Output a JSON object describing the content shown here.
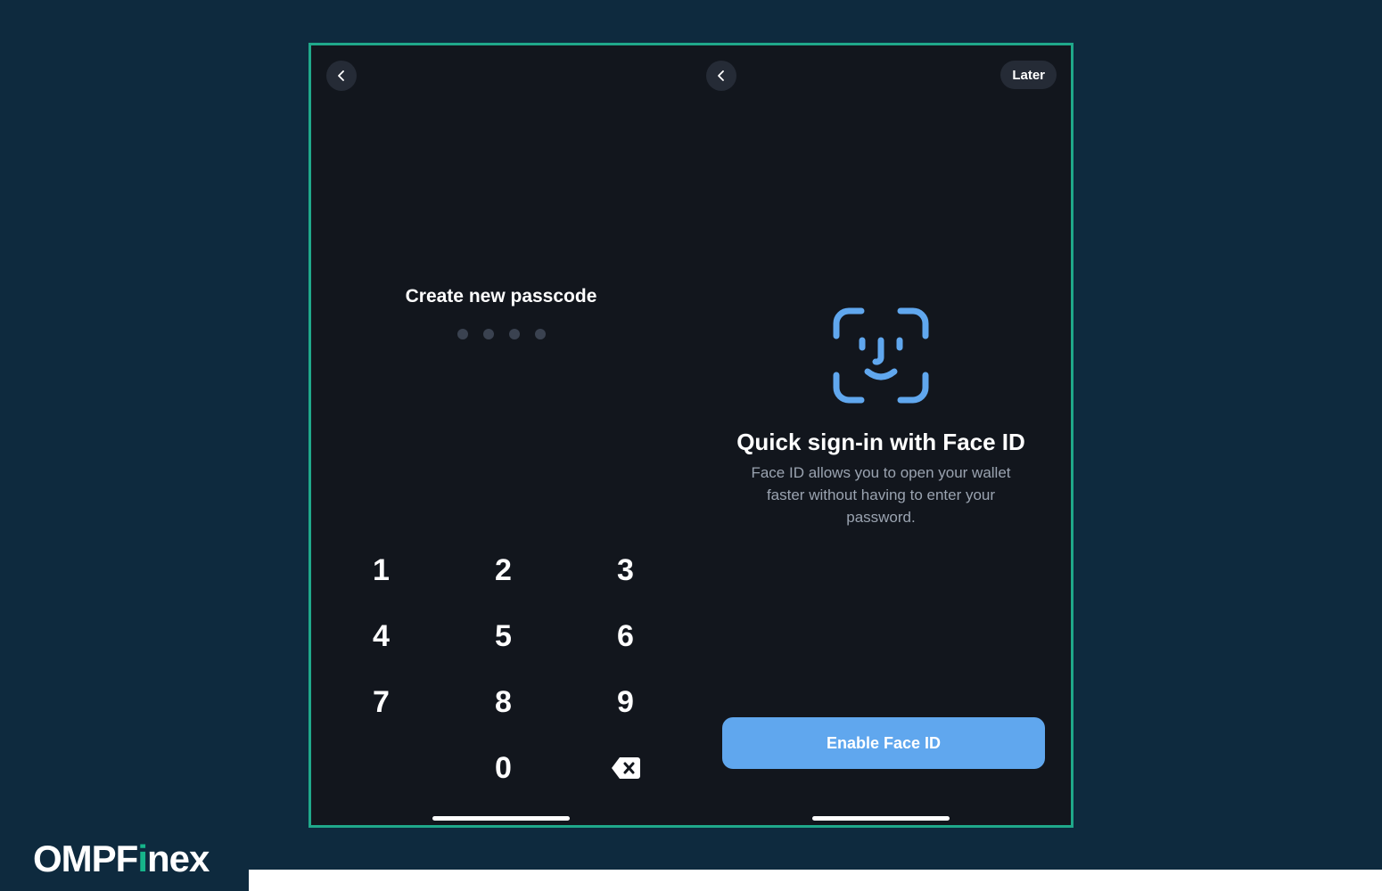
{
  "colors": {
    "background": "#0e2a3e",
    "frame_border": "#1fa88a",
    "screen_bg": "#12161d",
    "accent_blue": "#60a7ee",
    "brand_accent": "#16b48a"
  },
  "passcode_screen": {
    "back_icon": "chevron-left-icon",
    "title": "Create new passcode",
    "dots": 4,
    "keys": [
      "1",
      "2",
      "3",
      "4",
      "5",
      "6",
      "7",
      "8",
      "9",
      "",
      "0",
      "backspace"
    ]
  },
  "faceid_screen": {
    "back_icon": "chevron-left-icon",
    "later_label": "Later",
    "icon": "face-id-icon",
    "title": "Quick sign-in with Face ID",
    "description": "Face ID allows you to open your wallet faster without having to enter your password.",
    "enable_label": "Enable Face ID"
  },
  "brand": {
    "part1": "OMPF",
    "part2": "i",
    "part3": "nex"
  }
}
